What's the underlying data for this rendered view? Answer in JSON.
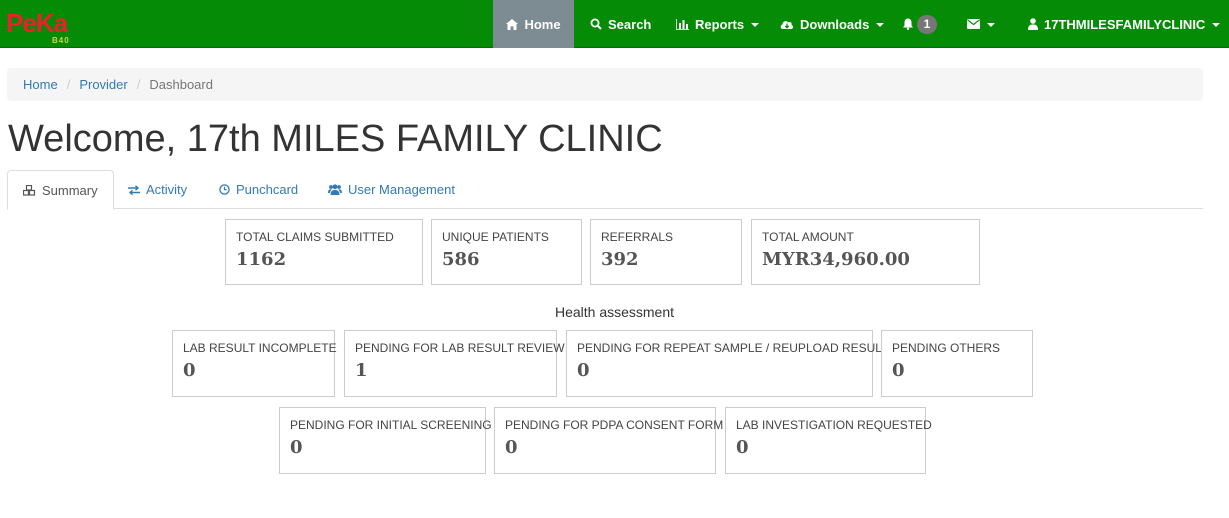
{
  "brand": {
    "logo_text": "PeKa",
    "logo_sub": "B40"
  },
  "navbar": {
    "home": "Home",
    "search": "Search",
    "reports": "Reports",
    "downloads": "Downloads",
    "notifications_count": "1",
    "user": "17THMILESFAMILYCLINIC"
  },
  "breadcrumb": {
    "home": "Home",
    "provider": "Provider",
    "current": "Dashboard"
  },
  "page_title": "Welcome, 17th MILES FAMILY CLINIC",
  "tabs": {
    "summary": "Summary",
    "activity": "Activity",
    "punchcard": "Punchcard",
    "user_management": "User Management"
  },
  "summary_stats": [
    {
      "label": "TOTAL CLAIMS SUBMITTED",
      "value": "1162"
    },
    {
      "label": "UNIQUE PATIENTS",
      "value": "586"
    },
    {
      "label": "REFERRALS",
      "value": "392"
    },
    {
      "label": "TOTAL AMOUNT",
      "value": "MYR34,960.00"
    }
  ],
  "health_assessment": {
    "title": "Health assessment",
    "row1": [
      {
        "label": "LAB RESULT INCOMPLETE",
        "value": "0"
      },
      {
        "label": "PENDING FOR LAB RESULT REVIEW",
        "value": "1"
      },
      {
        "label": "PENDING FOR REPEAT SAMPLE / REUPLOAD RESULT",
        "value": "0"
      },
      {
        "label": "PENDING OTHERS",
        "value": "0"
      }
    ],
    "row2": [
      {
        "label": "PENDING FOR INITIAL SCREENING",
        "value": "0"
      },
      {
        "label": "PENDING FOR PDPA CONSENT FORM",
        "value": "0"
      },
      {
        "label": "LAB INVESTIGATION REQUESTED",
        "value": "0"
      }
    ]
  },
  "colors": {
    "navbar": "#058b05",
    "active_nav": "#7d8b92",
    "link": "#337ab7",
    "logo": "#e8212b"
  },
  "icons": [
    "home-icon",
    "search-icon",
    "bar-chart-icon",
    "cloud-download-icon",
    "bell-icon",
    "envelope-icon",
    "user-icon",
    "cubes-icon",
    "exchange-icon",
    "clock-icon",
    "users-icon"
  ]
}
